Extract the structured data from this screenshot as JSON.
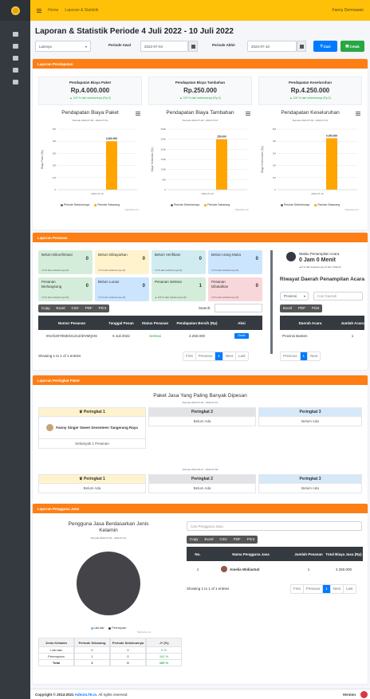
{
  "topbar": {
    "home": "Home",
    "current": "Laporan & Statistik",
    "user": "Fanny Dermawan"
  },
  "page_title": "Laporan & Statistik Periode 4 Juli 2022 - 10 Juli 2022",
  "filter": {
    "select_value": "Lainnya",
    "periode_awal_label": "Periode Awal",
    "periode_awal": "2022-07-04",
    "periode_akhir_label": "Periode Akhir",
    "periode_akhir": "2022-07-10",
    "cari": "Cari",
    "cetak": "Cetak"
  },
  "pendapatan": {
    "header": "Laporan Pendapatan",
    "stats": [
      {
        "title": "Pendapatan Biaya Paket",
        "value": "Rp.4.000.000",
        "sub": "▲ 100 % dari sebelumnya (Rp.0)"
      },
      {
        "title": "Pendapatan Biaya Tambahan",
        "value": "Rp.250.000",
        "sub": "▲ 100 % dari sebelumnya (Rp.0)"
      },
      {
        "title": "Pendapatan Keseluruhan",
        "value": "Rp.4.250.000",
        "sub": "▲ 100 % dari sebelumnya (Rp.0)"
      }
    ],
    "credit": "Highcharts.com"
  },
  "chart_data": [
    {
      "type": "bar",
      "title": "Pendapatan Biaya Paket",
      "subtitle": "Periode 2022-07-04 - 2022-07-10",
      "categories": [
        "2022-07-10"
      ],
      "ylabel": "Biaya Paket (Rp)",
      "ylim": [
        0,
        5000000
      ],
      "yticks": [
        "0",
        "1M",
        "2M",
        "3M",
        "4M",
        "5M"
      ],
      "series": [
        {
          "name": "Periode Sebelumnya",
          "color": "#666666",
          "values": [
            0
          ]
        },
        {
          "name": "Periode Sekarang",
          "color": "#ffa500",
          "values": [
            4000000
          ]
        }
      ],
      "data_labels": [
        "4.000.000"
      ],
      "legend": "bottom"
    },
    {
      "type": "bar",
      "title": "Pendapatan Biaya Tambahan",
      "subtitle": "Periode 2022-07-04 - 2022-07-10",
      "categories": [
        "2022-07-10"
      ],
      "ylabel": "Biaya Tambahan (Rp)",
      "ylim": [
        0,
        300000
      ],
      "yticks": [
        "0",
        "50k",
        "100k",
        "150k",
        "200k",
        "250k",
        "300k"
      ],
      "series": [
        {
          "name": "Periode Sebelumnya",
          "color": "#666666",
          "values": [
            0
          ]
        },
        {
          "name": "Periode Sekarang",
          "color": "#ffa500",
          "values": [
            250000
          ]
        }
      ],
      "data_labels": [
        "250.000"
      ],
      "legend": "bottom"
    },
    {
      "type": "bar",
      "title": "Pendapatan Keseluruhan",
      "subtitle": "Periode 2022-07-04 - 2022-07-10",
      "categories": [
        "2022-07-10"
      ],
      "ylabel": "Biaya Keseluruhan (Rp)",
      "ylim": [
        0,
        5000000
      ],
      "yticks": [
        "0",
        "1M",
        "2M",
        "3M",
        "4M",
        "5M"
      ],
      "series": [
        {
          "name": "Periode Sebelumnya",
          "color": "#666666",
          "values": [
            0
          ]
        },
        {
          "name": "Periode Sekarang",
          "color": "#ffa500",
          "values": [
            4250000
          ]
        }
      ],
      "data_labels": [
        "4.250.000"
      ],
      "legend": "bottom"
    },
    {
      "type": "pie",
      "title": "Pengguna Jasa Berdasarkan Jenis Kelamin",
      "subtitle": "Periode 2022-07-04 - 2022-07-10",
      "categories": [
        "Laki-laki",
        "Perempuan"
      ],
      "values": [
        0,
        1
      ],
      "colors": [
        "#7cb5ec",
        "#434348"
      ],
      "legend": "bottom"
    }
  ],
  "pesanan": {
    "header": "Laporan Pesanan",
    "boxes": [
      {
        "label": "Belum Dikonfirmasi",
        "count": "0",
        "sub": "=0 % dari sebelumnya (0)",
        "color": "#d4edda"
      },
      {
        "label": "Belum Dibayarkan",
        "count": "0",
        "sub": "=0 % dari sebelumnya (0)",
        "color": "#fff3cd"
      },
      {
        "label": "Belum Verifikasi",
        "count": "0",
        "sub": "=0 % dari sebelumnya (0)",
        "color": "#d1ecf1"
      },
      {
        "label": "Belum Uang Muka",
        "count": "0",
        "sub": "=0 % dari sebelumnya (0)",
        "color": "#cce5ff"
      },
      {
        "label": "Pesanan Berlangsung",
        "count": "0",
        "sub": "=0 % dari sebelumnya (0)",
        "color": "#d4edda"
      },
      {
        "label": "Belum Lunas",
        "count": "0",
        "sub": "=0 % dari sebelumnya (0)",
        "color": "#cce5ff"
      },
      {
        "label": "Pesanan Selesai",
        "count": "1",
        "sub": "▲ 100 % dari sebelumnya (0)",
        "color": "#d4edda"
      },
      {
        "label": "Pesanan Dibatalkan",
        "count": "0",
        "sub": "=0 % dari sebelumnya (0)",
        "color": "#f8d7da"
      }
    ],
    "buttons": [
      "Copy",
      "Excel",
      "CSV",
      "PDF",
      "Print"
    ],
    "search_label": "Search:",
    "columns": [
      "Nomor Pesanan",
      "Tanggal Pesan",
      "Status Pesanan",
      "Pendapatan Bersih (Rp)",
      "Aksi"
    ],
    "rows": [
      {
        "nomor": "INV/22070830/21213/3/VMQHS",
        "tanggal": "5 Juli 2022",
        "status": "Selesai",
        "pendapatan": "4.250.000",
        "aksi": "Detail"
      }
    ],
    "info": "Showing 1 to 1 of 1 entries",
    "pager": [
      "First",
      "Previous",
      "1",
      "Next",
      "Last"
    ]
  },
  "waktu": {
    "title": "Waktu Penampilan Acara",
    "value": "0 Jam 0 Menit",
    "sub": "▲0 % dari sebelumnya (0 Jam 0 Menit)"
  },
  "riwayat": {
    "title": "Riwayat Daerah Penampilan Acara",
    "select": "Provinsi",
    "placeholder": "Cari Daerah",
    "buttons": [
      "Excel",
      "PDF",
      "Print"
    ],
    "columns": [
      "Daerah Acara",
      "Jumlah Acara"
    ],
    "rows": [
      {
        "daerah": "Provinsi Banten",
        "jumlah": "1"
      }
    ],
    "pager": [
      "Previous",
      "1",
      "Next"
    ]
  },
  "peringkat": {
    "header": "Laporan Peringkat Paket",
    "title": "Paket Jasa Yang Paling Banyak Dipesan",
    "periode1": "Periode 2022-07-04 - 2022-07-10",
    "periode2": "Periode 2022-06-27 - 2022-07-03",
    "ranks": [
      "Peringkat 1",
      "Peringkat 2",
      "Peringkat 3"
    ],
    "current": {
      "p1": "Fanny Singer Sweet Seventeen Tangerang Raya",
      "p1_sub": "Sebanyak 1 Pesanan",
      "p2": "Belum Ada",
      "p3": "Belum Ada"
    },
    "previous": {
      "p1": "Belum Ada",
      "p2": "Belum Ada",
      "p3": "Belum Ada"
    }
  },
  "pengguna": {
    "header": "Laporan Pengguna Jasa",
    "credit": "Highcharts.com",
    "gender_table": {
      "columns": [
        "Jenis Kelamin",
        "Periode Sekarang",
        "Periode Sebelumnya",
        "-/+ (%)"
      ],
      "rows": [
        [
          "Laki-laki",
          "0",
          "0",
          "0 %"
        ],
        [
          "Perempuan",
          "1",
          "0",
          "100 %"
        ],
        [
          "Total",
          "1",
          "0",
          "100 %"
        ]
      ]
    },
    "search_placeholder": "Cari Pengguna Jasa",
    "buttons": [
      "Copy",
      "Excel",
      "CSV",
      "PDF",
      "Print"
    ],
    "columns": [
      "No.",
      "Nama Pengguna Jasa",
      "Jumlah Pesanan",
      "Total Biaya Jasa (Rp)"
    ],
    "rows": [
      {
        "no": "1",
        "nama": "Amelia Widiastuti",
        "jumlah": "1",
        "total": "4.250.000"
      }
    ],
    "info": "Showing 1 to 1 of 1 entries",
    "pager": [
      "First",
      "Previous",
      "1",
      "Next",
      "Last"
    ]
  },
  "footer": {
    "copyright": "Copyright © 2014-2021 ",
    "brand": "AdminLTE.io.",
    "rights": " All rights reserved.",
    "version": "Version"
  }
}
